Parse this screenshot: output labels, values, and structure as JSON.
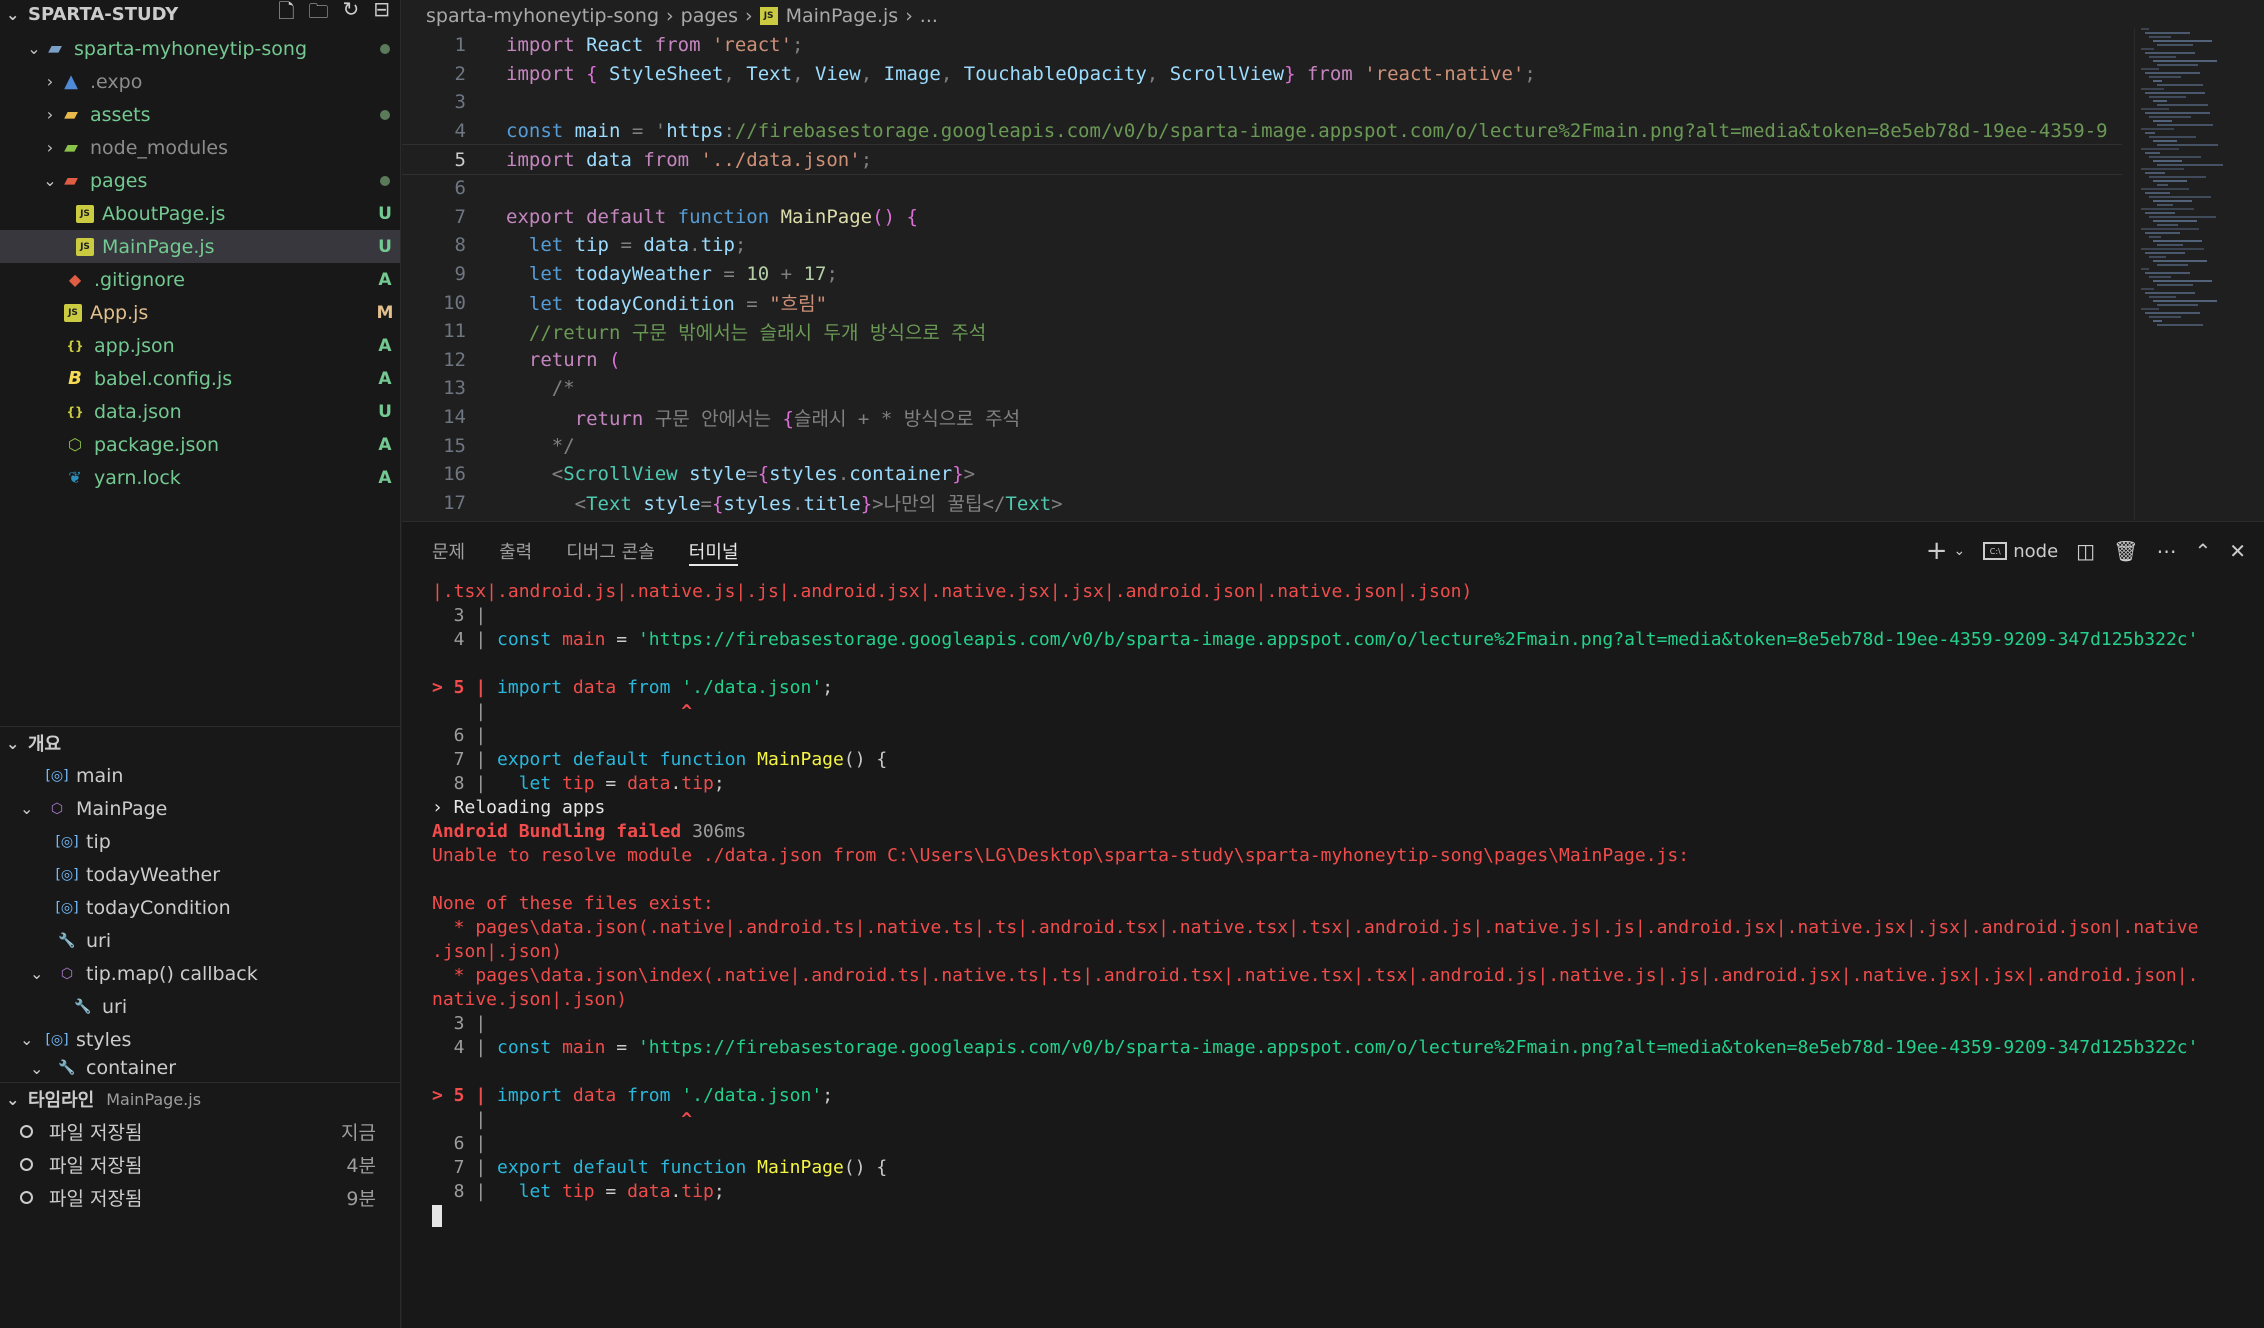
{
  "explorer": {
    "title": "SPARTA-STUDY",
    "items": [
      {
        "label": "sparta-myhoneytip-song",
        "badge": "●"
      },
      {
        "label": ".expo",
        "badge": ""
      },
      {
        "label": "assets",
        "badge": "●"
      },
      {
        "label": "node_modules",
        "badge": ""
      },
      {
        "label": "pages",
        "badge": "●"
      },
      {
        "label": "AboutPage.js",
        "badge": "U"
      },
      {
        "label": "MainPage.js",
        "badge": "U"
      },
      {
        "label": ".gitignore",
        "badge": "A"
      },
      {
        "label": "App.js",
        "badge": "M"
      },
      {
        "label": "app.json",
        "badge": "A"
      },
      {
        "label": "babel.config.js",
        "badge": "A"
      },
      {
        "label": "data.json",
        "badge": "U"
      },
      {
        "label": "package.json",
        "badge": "A"
      },
      {
        "label": "yarn.lock",
        "badge": "A"
      }
    ]
  },
  "outline": {
    "title": "개요",
    "items": [
      {
        "label": "main"
      },
      {
        "label": "MainPage"
      },
      {
        "label": "tip"
      },
      {
        "label": "todayWeather"
      },
      {
        "label": "todayCondition"
      },
      {
        "label": "uri"
      },
      {
        "label": "tip.map() callback"
      },
      {
        "label": "uri"
      },
      {
        "label": "styles"
      },
      {
        "label": "container"
      }
    ]
  },
  "timeline": {
    "title": "타임라인",
    "file": "MainPage.js",
    "items": [
      {
        "label": "파일 저장됨",
        "time": "지금"
      },
      {
        "label": "파일 저장됨",
        "time": "4분"
      },
      {
        "label": "파일 저장됨",
        "time": "9분"
      }
    ]
  },
  "breadcrumb": [
    "sparta-myhoneytip-song",
    "pages",
    "MainPage.js",
    "..."
  ],
  "code_lines": [
    "import React from 'react';",
    "import { StyleSheet, Text, View, Image, TouchableOpacity, ScrollView} from 'react-native';",
    "",
    "const main = 'https://firebasestorage.googleapis.com/v0/b/sparta-image.appspot.com/o/lecture%2Fmain.png?alt=media&token=8e5eb78d-19ee-4359-9",
    "import data from '../data.json';",
    "",
    "export default function MainPage() {",
    "  let tip = data.tip;",
    "  let todayWeather = 10 + 17;",
    "  let todayCondition = \"흐림\"",
    "  //return 구문 밖에서는 슬래시 두개 방식으로 주석",
    "  return (",
    "    /*",
    "      return 구문 안에서는 {슬래시 + * 방식으로 주석",
    "    */",
    "    <ScrollView style={styles.container}>",
    "      <Text style={styles.title}>나만의 꿀팁</Text>"
  ],
  "panel": {
    "tabs": [
      "문제",
      "출력",
      "디버그 콘솔",
      "터미널"
    ],
    "active_tab": "터미널",
    "shell": "node"
  },
  "terminal_lines": [
    "|.tsx|.android.js|.native.js|.js|.android.jsx|.native.jsx|.jsx|.android.json|.native.json|.json)",
    "  3 |",
    "  4 | const main = 'https://firebasestorage.googleapis.com/v0/b/sparta-image.appspot.com/o/lecture%2Fmain.png?alt=media&token=8e5eb78d-19ee-4359-9209-347d125b322c'",
    "",
    "> 5 | import data from './data.json';",
    "    |                  ^",
    "  6 |",
    "  7 | export default function MainPage() {",
    "  8 |   let tip = data.tip;",
    "› Reloading apps",
    "Android Bundling failed 306ms",
    "Unable to resolve module ./data.json from C:\\Users\\LG\\Desktop\\sparta-study\\sparta-myhoneytip-song\\pages\\MainPage.js:",
    "",
    "None of these files exist:",
    "  * pages\\data.json(.native|.android.ts|.native.ts|.ts|.android.tsx|.native.tsx|.tsx|.android.js|.native.js|.js|.android.jsx|.native.jsx|.jsx|.android.json|.native",
    ".json|.json)",
    "  * pages\\data.json\\index(.native|.android.ts|.native.ts|.ts|.android.tsx|.native.tsx|.tsx|.android.js|.native.js|.js|.android.jsx|.native.jsx|.jsx|.android.json|.",
    "native.json|.json)",
    "  3 |",
    "  4 | const main = 'https://firebasestorage.googleapis.com/v0/b/sparta-image.appspot.com/o/lecture%2Fmain.png?alt=media&token=8e5eb78d-19ee-4359-9209-347d125b322c'",
    "",
    "> 5 | import data from './data.json';",
    "    |                  ^",
    "  6 |",
    "  7 | export default function MainPage() {",
    "  8 |   let tip = data.tip;"
  ],
  "colors": {
    "sidebar_bg": "#181818",
    "editor_bg": "#1f1f1f",
    "selection": "#37373d",
    "git_untracked": "#73c991",
    "git_modified": "#e2c08d",
    "error": "#f14c4c"
  }
}
